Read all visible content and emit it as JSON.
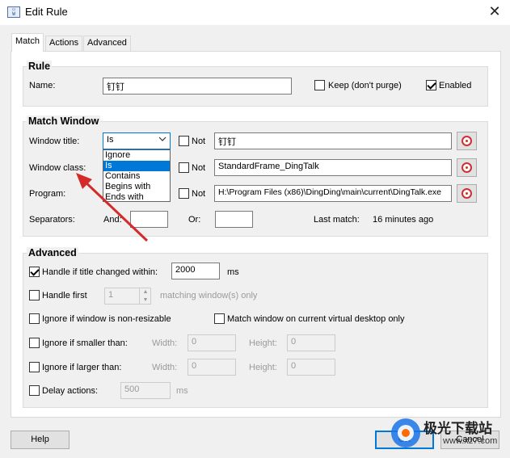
{
  "window": {
    "title": "Edit Rule",
    "icon": "app-window-icon",
    "close_glyph": "✕"
  },
  "tabs": [
    {
      "label": "Match",
      "active": true
    },
    {
      "label": "Actions",
      "active": false
    },
    {
      "label": "Advanced",
      "active": false
    }
  ],
  "rule": {
    "group_title": "Rule",
    "name_label": "Name:",
    "name_value": "钉钉",
    "keep_label": "Keep (don't purge)",
    "keep_checked": false,
    "enabled_label": "Enabled",
    "enabled_checked": true
  },
  "match_window": {
    "group_title": "Match Window",
    "title_label": "Window title:",
    "title_mode": "Is",
    "title_not_label": "Not",
    "title_value": "钉钉",
    "class_label": "Window class:",
    "class_not_label": "Not",
    "class_value": "StandardFrame_DingTalk",
    "program_label": "Program:",
    "program_not_label": "Not",
    "program_value": "H:\\Program Files (x86)\\DingDing\\main\\current\\DingTalk.exe",
    "separators_label": "Separators:",
    "and_label": "And:",
    "and_value": "",
    "or_label": "Or:",
    "or_value": "",
    "last_match_label": "Last match:",
    "last_match_value": "16 minutes ago",
    "dropdown_options": [
      "Ignore",
      "Is",
      "Contains",
      "Begins with",
      "Ends with"
    ],
    "dropdown_selected": "Is"
  },
  "advanced": {
    "group_title": "Advanced",
    "title_changed_label": "Handle if title changed within:",
    "title_changed_checked": true,
    "title_changed_value": "2000",
    "title_changed_unit": "ms",
    "handle_first_label": "Handle first",
    "handle_first_checked": false,
    "handle_first_value": "1",
    "handle_first_suffix": "matching window(s) only",
    "non_resizable_label": "Ignore if window is non-resizable",
    "non_resizable_checked": false,
    "virtual_desktop_label": "Match window on current virtual desktop only",
    "virtual_desktop_checked": false,
    "smaller_label": "Ignore if smaller than:",
    "smaller_checked": false,
    "smaller_width_label": "Width:",
    "smaller_width_value": "0",
    "smaller_height_label": "Height:",
    "smaller_height_value": "0",
    "larger_label": "Ignore if larger than:",
    "larger_checked": false,
    "larger_width_label": "Width:",
    "larger_width_value": "0",
    "larger_height_label": "Height:",
    "larger_height_value": "0",
    "delay_label": "Delay actions:",
    "delay_checked": false,
    "delay_value": "500",
    "delay_unit": "ms"
  },
  "buttons": {
    "help": "Help",
    "ok": "OK",
    "cancel": "Cancel"
  },
  "watermark": {
    "text": "极光下载站",
    "url": "www.xz7.com"
  },
  "colors": {
    "accent": "#0078d7",
    "arrow": "#d42a2a",
    "target": "#d03030"
  }
}
